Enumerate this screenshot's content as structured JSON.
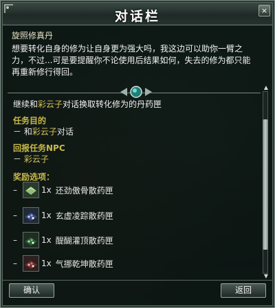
{
  "dialog": {
    "title": "对话栏",
    "close_label": "×",
    "quest_name": "旋照修真丹",
    "description": "想要转化自身的修为让自身更为强大吗，我这边可以助你一臂之力，不过...可是要提醒你不论使用后结果如何，失去的修为都只能再重新修行得回。",
    "task": {
      "prefix": "继续和",
      "npc": "彩云子",
      "suffix": "对话换取转化修为的丹药匣"
    },
    "objective": {
      "header": "任务目的",
      "prefix": "－ 和",
      "npc": "彩云子",
      "suffix": "对话"
    },
    "return_npc": {
      "header": "回报任务NPC",
      "prefix": "－ ",
      "npc": "彩云子"
    },
    "rewards": {
      "header": "奖励选项：",
      "items": [
        {
          "qty": "1x",
          "name": "还劲傲骨散药匣",
          "icon": "herb-box-icon"
        },
        {
          "qty": "1x",
          "name": "玄虚凌踪散药匣",
          "icon": "gem-box-blue-icon"
        },
        {
          "qty": "1x",
          "name": "醍醐灌顶散药匣",
          "icon": "gem-box-green-icon"
        },
        {
          "qty": "1x",
          "name": "气挪乾坤散药匣",
          "icon": "gem-box-red-icon"
        }
      ]
    },
    "buttons": {
      "ok": "确认",
      "back": "返回"
    }
  },
  "colors": {
    "highlight": "#d6c35a",
    "section": "#c9b94a",
    "text": "#f2f2f2"
  }
}
